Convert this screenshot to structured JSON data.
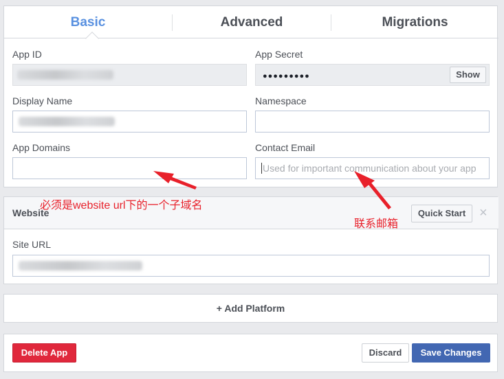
{
  "tabs": [
    {
      "label": "Basic",
      "active": true
    },
    {
      "label": "Advanced",
      "active": false
    },
    {
      "label": "Migrations",
      "active": false
    }
  ],
  "basic": {
    "app_id_label": "App ID",
    "app_secret_label": "App Secret",
    "app_secret_value": "●●●●●●●●●",
    "show_label": "Show",
    "display_name_label": "Display Name",
    "namespace_label": "Namespace",
    "app_domains_label": "App Domains",
    "contact_email_label": "Contact Email",
    "contact_email_placeholder": "Used for important communication about your app"
  },
  "website": {
    "title": "Website",
    "quick_start_label": "Quick Start",
    "close_glyph": "×",
    "site_url_label": "Site URL"
  },
  "add_platform_label": "+ Add Platform",
  "footer": {
    "delete_label": "Delete App",
    "discard_label": "Discard",
    "save_label": "Save Changes"
  },
  "annotations": {
    "domain_note": "必须是website url下的一个子域名",
    "email_note": "联系邮箱",
    "color": "#e8202a"
  }
}
